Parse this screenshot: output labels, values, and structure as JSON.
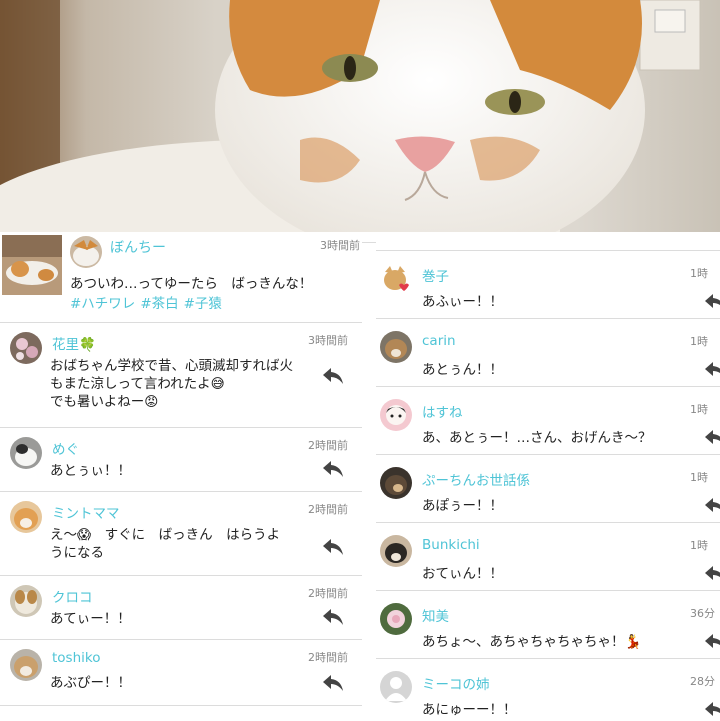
{
  "post": {
    "name": "ぼんちー",
    "time": "3時間前",
    "text": "あついわ…ってゆーたら　ばっきんな！",
    "tags": [
      "#ハチワレ",
      "#茶白",
      "#子猿"
    ]
  },
  "comments_left": [
    {
      "name": "花里🍀",
      "time": "3時間前",
      "text": "おばちゃん学校で昔、心頭滅却すれば火\nもまた涼しって言われたよ😅\nでも暑いよねー😡",
      "avatar": "flower-photo-avatar",
      "reply_icon": "reply-arrow-icon"
    },
    {
      "name": "めぐ",
      "time": "2時間前",
      "text": "あとぅぃ！！",
      "avatar": "cat-photo-avatar",
      "reply_icon": "reply-arrow-icon"
    },
    {
      "name": "ミントママ",
      "time": "2時間前",
      "text": "え〜😱　すぐに　ばっきん　はらうよ\nうになる",
      "avatar": "orange-cat-avatar",
      "reply_icon": "reply-arrow-icon"
    },
    {
      "name": "クロコ",
      "time": "2時間前",
      "text": "あてぃー！！",
      "avatar": "dog-photo-avatar",
      "reply_icon": "reply-arrow-icon"
    },
    {
      "name": "toshiko",
      "time": "2時間前",
      "text": "あぶぴー！！",
      "avatar": "tabby-cat-avatar",
      "reply_icon": "reply-arrow-icon"
    }
  ],
  "comments_right": [
    {
      "name": "巻子",
      "time": "1時",
      "text": "あふぃー！！",
      "avatar": "cat-heart-sticker-avatar",
      "reply_icon": "reply-arrow-icon"
    },
    {
      "name": "carin",
      "time": "1時",
      "text": "あとぅん！！",
      "avatar": "cat-photo-avatar",
      "reply_icon": "reply-arrow-icon"
    },
    {
      "name": "はすね",
      "time": "1時",
      "text": "あ、あとぅー！…さん、おげんき〜？",
      "avatar": "character-avatar",
      "reply_icon": "reply-arrow-icon"
    },
    {
      "name": "ぷーちんお世話係",
      "time": "1時",
      "text": "あぽぅー！！",
      "avatar": "cat-photo-avatar",
      "reply_icon": "reply-arrow-icon"
    },
    {
      "name": "Bunkichi",
      "time": "1時",
      "text": "おてぃん！！",
      "avatar": "cat-photo-avatar",
      "reply_icon": "reply-arrow-icon"
    },
    {
      "name": "知美",
      "time": "36分",
      "text": "あちょ〜、あちゃちゃちゃちゃ！💃",
      "avatar": "flower-photo-avatar",
      "reply_icon": "reply-arrow-icon"
    },
    {
      "name": "ミーコの姉",
      "time": "28分",
      "text": "あにゅーー！！",
      "avatar": "default-user-avatar",
      "reply_icon": "reply-arrow-icon"
    }
  ],
  "colors": {
    "name": "#4fc4d6",
    "text": "#222222",
    "time": "#888888",
    "divider": "#dcdcdc",
    "reply": "#444444"
  }
}
